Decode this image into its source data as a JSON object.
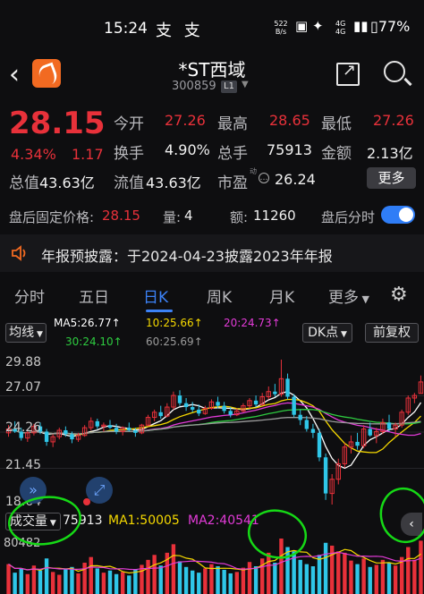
{
  "status_bar": {
    "time": "15:24",
    "alipay_icons": "支 支",
    "net_speed": "522",
    "net_unit": "B/s",
    "signal": "4G",
    "signal2": "4G",
    "battery": "77%"
  },
  "header": {
    "name": "*ST西域",
    "code": "300859",
    "level": "L1"
  },
  "quote": {
    "price": "28.15",
    "pct": "4.34%",
    "change": "1.17",
    "rows": [
      [
        {
          "label": "今开",
          "value": "27.26",
          "color": "#e8313a"
        },
        {
          "label": "最高",
          "value": "28.65",
          "color": "#e8313a"
        },
        {
          "label": "最低",
          "value": "27.26",
          "color": "#e8313a"
        }
      ],
      [
        {
          "label": "换手",
          "value": "4.90%",
          "color": "#f0f0f0"
        },
        {
          "label": "总手",
          "value": "75913",
          "color": "#f0f0f0"
        },
        {
          "label": "金额",
          "value": "2.13亿",
          "color": "#f0f0f0"
        }
      ]
    ],
    "total_value_label": "总值",
    "total_value": "43.63亿",
    "float_value_label": "流值",
    "float_value": "43.63亿",
    "pe_label": "市盈",
    "pe_sup": "动",
    "pe_value": "26.24",
    "more_label": "更多"
  },
  "after_hours": {
    "price_label": "盘后固定价格:",
    "price": "28.15",
    "vol_label": "量:",
    "vol": "4",
    "amount_label": "额:",
    "amount": "11260",
    "timeshare_label": "盘后分时"
  },
  "notice": {
    "text": "年报预披露：于2024-04-23披露2023年年报"
  },
  "tabs": [
    "分时",
    "五日",
    "日K",
    "周K",
    "月K",
    "更多"
  ],
  "active_tab": "日K",
  "chart_controls": {
    "ma_button": "均线",
    "dk_button": "DK点",
    "adjust_button": "前复权",
    "ma5": "MA5:26.77↑",
    "ma10": "10:25.66↑",
    "ma20": "20:24.73↑",
    "ma30": "30:24.10↑",
    "ma60": "60:25.69↑"
  },
  "y_axis": [
    "29.88",
    "27.07",
    "24.26",
    "21.45",
    "18.64"
  ],
  "volume": {
    "selector": "成交量",
    "value": "75913",
    "ma1": "MA1:50005",
    "ma2": "MA2:40541",
    "axis_top": "80482"
  },
  "colors": {
    "up": "#e8313a",
    "down": "#2fc6e8",
    "ma5": "#ffffff",
    "ma10": "#f5d800",
    "ma20": "#e33bd8",
    "ma30": "#2ecc40",
    "ma60": "#9a9a9a",
    "annotation": "#16d916",
    "active": "#3c82f7"
  },
  "chart_data": {
    "type": "candlestick",
    "ylim": [
      18.64,
      29.88
    ],
    "candles": [
      [
        24.2,
        24.8,
        23.9,
        24.5
      ],
      [
        24.5,
        25.1,
        24.2,
        24.3
      ],
      [
        24.3,
        24.6,
        23.6,
        23.8
      ],
      [
        23.8,
        24.4,
        23.5,
        24.2
      ],
      [
        24.2,
        24.9,
        24.0,
        24.7
      ],
      [
        24.7,
        25.0,
        24.1,
        24.3
      ],
      [
        24.3,
        24.5,
        23.2,
        23.5
      ],
      [
        23.5,
        24.1,
        23.1,
        23.9
      ],
      [
        23.9,
        24.6,
        23.7,
        24.4
      ],
      [
        24.4,
        24.7,
        23.9,
        24.1
      ],
      [
        24.1,
        24.3,
        23.4,
        23.7
      ],
      [
        23.7,
        24.2,
        23.5,
        24.0
      ],
      [
        24.0,
        24.8,
        23.9,
        24.6
      ],
      [
        24.6,
        25.4,
        24.4,
        25.1
      ],
      [
        25.1,
        25.3,
        24.5,
        24.7
      ],
      [
        24.7,
        25.0,
        24.3,
        24.8
      ],
      [
        24.8,
        25.2,
        24.5,
        24.6
      ],
      [
        24.6,
        24.9,
        24.1,
        24.3
      ],
      [
        24.3,
        24.7,
        24.0,
        24.6
      ],
      [
        24.6,
        25.0,
        24.3,
        24.4
      ],
      [
        24.4,
        24.6,
        23.9,
        24.2
      ],
      [
        24.2,
        24.9,
        24.1,
        24.8
      ],
      [
        24.8,
        25.6,
        24.7,
        25.4
      ],
      [
        25.4,
        26.0,
        25.1,
        25.8
      ],
      [
        25.8,
        26.3,
        25.3,
        25.5
      ],
      [
        25.5,
        26.5,
        25.4,
        26.2
      ],
      [
        26.2,
        27.4,
        26.0,
        27.1
      ],
      [
        27.1,
        27.5,
        26.3,
        26.5
      ],
      [
        26.5,
        26.9,
        25.9,
        26.2
      ],
      [
        26.2,
        26.6,
        25.8,
        26.0
      ],
      [
        26.0,
        26.4,
        25.5,
        25.7
      ],
      [
        25.7,
        26.3,
        25.6,
        26.1
      ],
      [
        26.1,
        26.8,
        26.0,
        26.6
      ],
      [
        26.6,
        27.0,
        26.1,
        26.3
      ],
      [
        26.3,
        26.6,
        25.7,
        25.9
      ],
      [
        25.9,
        26.2,
        25.4,
        25.6
      ],
      [
        25.6,
        26.1,
        25.5,
        25.9
      ],
      [
        25.9,
        26.5,
        25.8,
        26.3
      ],
      [
        26.3,
        26.9,
        26.1,
        26.7
      ],
      [
        26.7,
        27.1,
        26.2,
        26.4
      ],
      [
        26.4,
        27.3,
        26.3,
        27.0
      ],
      [
        27.0,
        27.8,
        26.8,
        27.4
      ],
      [
        27.4,
        28.0,
        27.0,
        27.2
      ],
      [
        27.2,
        29.88,
        27.0,
        28.4
      ],
      [
        28.4,
        28.8,
        26.8,
        27.0
      ],
      [
        27.0,
        27.2,
        25.4,
        25.6
      ],
      [
        25.6,
        26.0,
        24.8,
        25.2
      ],
      [
        25.2,
        25.5,
        24.3,
        24.5
      ],
      [
        24.5,
        24.9,
        23.8,
        24.2
      ],
      [
        24.2,
        24.5,
        22.0,
        22.3
      ],
      [
        22.3,
        22.6,
        19.0,
        19.5
      ],
      [
        19.5,
        21.0,
        18.64,
        20.6
      ],
      [
        20.6,
        22.2,
        20.2,
        21.8
      ],
      [
        21.8,
        23.4,
        21.5,
        23.1
      ],
      [
        23.1,
        24.0,
        22.6,
        23.5
      ],
      [
        23.5,
        24.2,
        22.9,
        23.2
      ],
      [
        23.2,
        24.8,
        23.0,
        24.5
      ],
      [
        24.5,
        25.0,
        23.9,
        24.0
      ],
      [
        24.0,
        24.6,
        23.4,
        24.3
      ],
      [
        24.3,
        25.3,
        24.1,
        25.0
      ],
      [
        25.0,
        25.6,
        24.3,
        24.5
      ],
      [
        24.5,
        25.0,
        23.9,
        24.8
      ],
      [
        24.8,
        26.0,
        24.6,
        25.8
      ],
      [
        25.8,
        27.1,
        25.6,
        26.9
      ],
      [
        26.9,
        27.3,
        26.5,
        27.1
      ],
      [
        27.26,
        28.65,
        27.26,
        28.15
      ]
    ],
    "volumes": [
      42,
      30,
      36,
      28,
      40,
      33,
      50,
      31,
      27,
      35,
      38,
      29,
      44,
      52,
      36,
      30,
      33,
      28,
      31,
      26,
      35,
      41,
      48,
      55,
      40,
      58,
      70,
      46,
      38,
      33,
      30,
      36,
      42,
      39,
      34,
      29,
      31,
      37,
      45,
      39,
      50,
      58,
      44,
      78,
      66,
      60,
      48,
      42,
      39,
      55,
      72,
      68,
      60,
      58,
      47,
      42,
      50,
      38,
      41,
      48,
      44,
      40,
      52,
      66,
      48,
      75
    ]
  }
}
